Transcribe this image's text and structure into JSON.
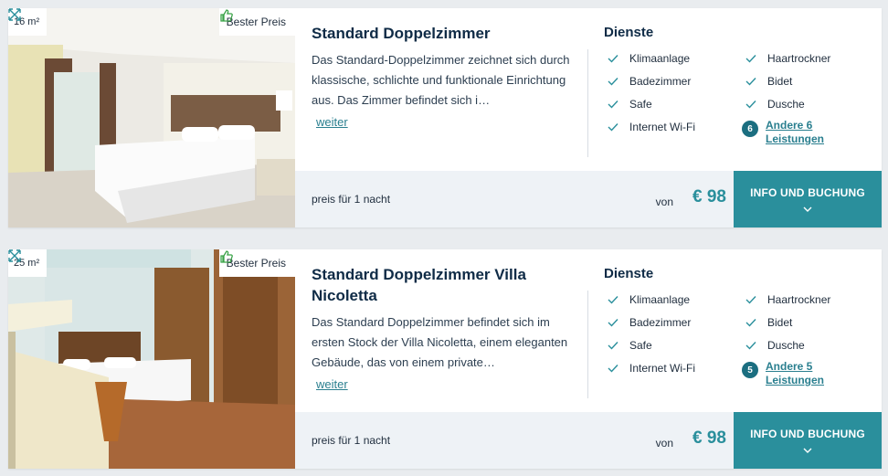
{
  "colors": {
    "accent": "#2a8f9c",
    "dark_teal": "#1b6e80",
    "title": "#0f2b46",
    "pricebar_bg": "#eef2f6",
    "check": "#2a8f9c"
  },
  "rooms": [
    {
      "size": "16 m²",
      "badge": "Bester Preis",
      "title": "Standard Doppelzimmer",
      "description": "Das Standard-Doppelzimmer zeichnet sich durch klassische, schlichte und funktionale Einrichtung aus. Das Zimmer befindet sich i…",
      "more_link": "weiter",
      "services_title": "Dienste",
      "services": [
        "Klimaanlage",
        "Haartrockner",
        "Badezimmer",
        "Bidet",
        "Safe",
        "Dusche",
        "Internet Wi-Fi"
      ],
      "other_count": "6",
      "other_label": "Andere 6 Leistungen",
      "price_text": "preis für 1 nacht",
      "von": "von",
      "price": "€ 98",
      "cta": "INFO UND BUCHUNG"
    },
    {
      "size": "25 m²",
      "badge": "Bester Preis",
      "title": "Standard Doppelzimmer Villa Nicoletta",
      "description": "Das Standard Doppelzimmer befindet sich im ersten Stock der Villa Nicoletta, einem eleganten Gebäude, das von einem private…",
      "more_link": "weiter",
      "services_title": "Dienste",
      "services": [
        "Klimaanlage",
        "Haartrockner",
        "Badezimmer",
        "Bidet",
        "Safe",
        "Dusche",
        "Internet Wi-Fi"
      ],
      "other_count": "5",
      "other_label": "Andere 5 Leistungen",
      "price_text": "preis für 1 nacht",
      "von": "von",
      "price": "€ 98",
      "cta": "INFO UND BUCHUNG"
    }
  ]
}
